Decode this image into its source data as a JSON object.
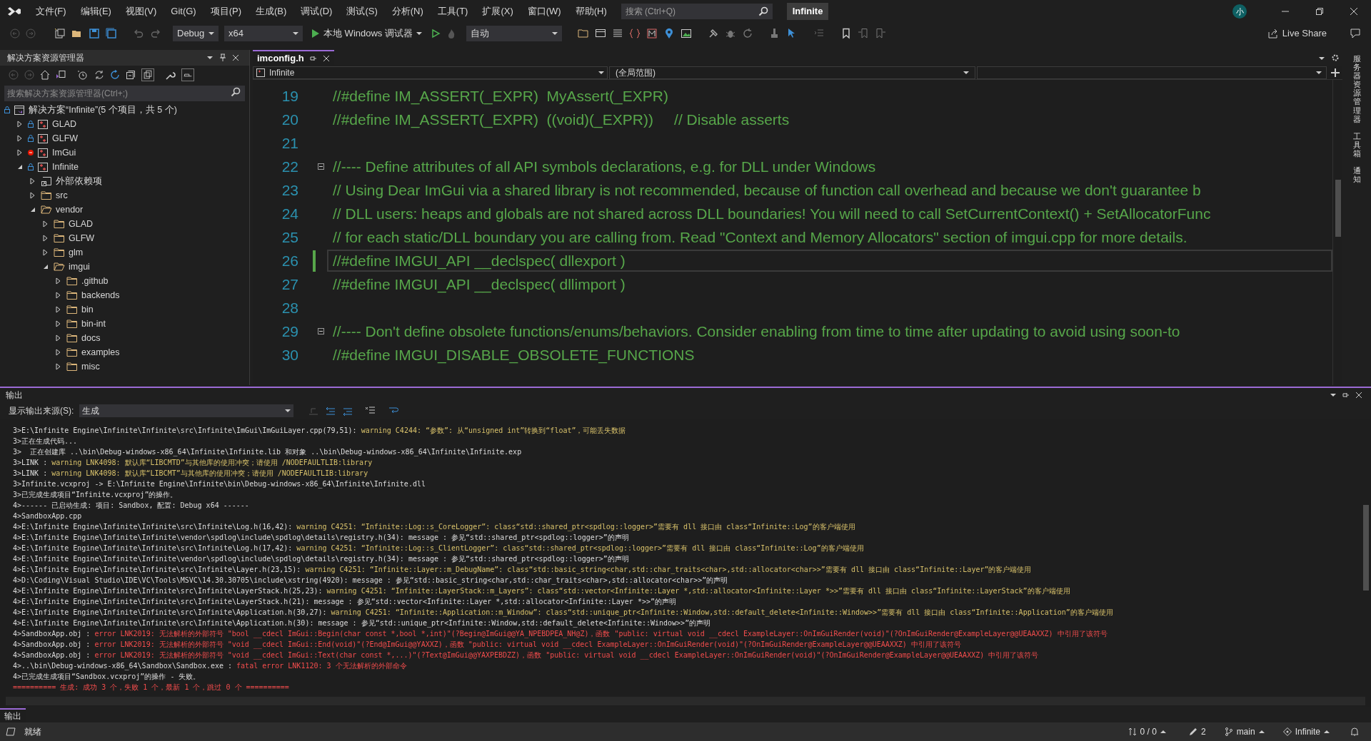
{
  "title_bar": {
    "menu": [
      "文件(F)",
      "编辑(E)",
      "视图(V)",
      "Git(G)",
      "项目(P)",
      "生成(B)",
      "调试(D)",
      "测试(S)",
      "分析(N)",
      "工具(T)",
      "扩展(X)",
      "窗口(W)",
      "帮助(H)"
    ],
    "search": {
      "placeholder": "搜索 (Ctrl+Q)"
    },
    "solution_badge": "Infinite",
    "account_initial": "小"
  },
  "toolbar": {
    "configuration": "Debug",
    "platform": "x64",
    "debugger": "本地 Windows 调试器",
    "target": "自动",
    "live_share": "Live Share"
  },
  "solution_explorer": {
    "title": "解决方案资源管理器",
    "search": {
      "placeholder": "搜索解决方案资源管理器(Ctrl+;)"
    },
    "tree": [
      {
        "label": "解决方案“Infinite”(5 个项目，共 5 个)",
        "kind": "solution",
        "locked": true,
        "has_error": false,
        "children": [
          {
            "label": "GLAD",
            "kind": "project",
            "locked": true,
            "has_error": false,
            "expanded": false
          },
          {
            "label": "GLFW",
            "kind": "project",
            "locked": true,
            "has_error": false,
            "expanded": false
          },
          {
            "label": "ImGui",
            "kind": "project",
            "locked": false,
            "has_error": true,
            "expanded": false
          },
          {
            "label": "Infinite",
            "kind": "project",
            "locked": true,
            "has_error": false,
            "expanded": true,
            "children": [
              {
                "label": "外部依赖项",
                "kind": "references",
                "expanded": false
              },
              {
                "label": "src",
                "kind": "folder",
                "expanded": false
              },
              {
                "label": "vendor",
                "kind": "folder",
                "expanded": true,
                "children": [
                  {
                    "label": "GLAD",
                    "kind": "folder",
                    "expanded": false
                  },
                  {
                    "label": "GLFW",
                    "kind": "folder",
                    "expanded": false
                  },
                  {
                    "label": "glm",
                    "kind": "folder",
                    "expanded": false
                  },
                  {
                    "label": "imgui",
                    "kind": "folder",
                    "expanded": true,
                    "children": [
                      {
                        "label": ".github",
                        "kind": "folder",
                        "expanded": false
                      },
                      {
                        "label": "backends",
                        "kind": "folder",
                        "expanded": false
                      },
                      {
                        "label": "bin",
                        "kind": "folder",
                        "expanded": false
                      },
                      {
                        "label": "bin-int",
                        "kind": "folder",
                        "expanded": false
                      },
                      {
                        "label": "docs",
                        "kind": "folder",
                        "expanded": false
                      },
                      {
                        "label": "examples",
                        "kind": "folder",
                        "expanded": false
                      },
                      {
                        "label": "misc",
                        "kind": "folder",
                        "expanded": false
                      }
                    ]
                  }
                ]
              }
            ]
          }
        ]
      }
    ]
  },
  "editor": {
    "tab": "imconfig.h",
    "project": "Infinite",
    "scope": "(全局范围)",
    "lines": [
      {
        "number": "19",
        "text": "//#define IM_ASSERT(_EXPR)  MyAssert(_EXPR)",
        "foldable": false,
        "current": false
      },
      {
        "number": "20",
        "text": "//#define IM_ASSERT(_EXPR)  ((void)(_EXPR))     // Disable asserts",
        "foldable": false,
        "current": false
      },
      {
        "number": "21",
        "foldable": false,
        "current": false
      },
      {
        "number": "22",
        "text": "//---- Define attributes of all API symbols declarations, e.g. for DLL under Windows",
        "foldable": true,
        "current": false
      },
      {
        "number": "23",
        "text": "// Using Dear ImGui via a shared library is not recommended, because of function call overhead and because we don't guarantee b",
        "foldable": false,
        "current": false
      },
      {
        "number": "24",
        "text": "// DLL users: heaps and globals are not shared across DLL boundaries! You will need to call SetCurrentContext() + SetAllocatorFunc",
        "foldable": false,
        "current": false
      },
      {
        "number": "25",
        "text": "// for each static/DLL boundary you are calling from. Read \"Context and Memory Allocators\" section of imgui.cpp for more details.",
        "foldable": false,
        "current": false
      },
      {
        "number": "26",
        "text": "//#define IMGUI_API __declspec( dllexport )",
        "foldable": false,
        "current": true
      },
      {
        "number": "27",
        "text": "//#define IMGUI_API __declspec( dllimport )",
        "foldable": false,
        "current": false
      },
      {
        "number": "28",
        "foldable": false,
        "current": false
      },
      {
        "number": "29",
        "text": "//---- Don't define obsolete functions/enums/behaviors. Consider enabling from time to time after updating to avoid using soon-to",
        "foldable": true,
        "current": false
      },
      {
        "number": "30",
        "text": "//#define IMGUI_DISABLE_OBSOLETE_FUNCTIONS",
        "foldable": false,
        "current": false
      }
    ]
  },
  "side_tabs": [
    "服务器资源管理器",
    "工具箱",
    "通知"
  ],
  "output": {
    "title": "输出",
    "source_label": "显示输出来源(S):",
    "source": "生成",
    "lines": [
      {
        "source": "3>E:\\Infinite Engine\\Infinite\\Infinite\\src\\Infinite\\ImGui\\ImGuiLayer.cpp(79,51): ",
        "text": "warning C4244: “参数”: 从“unsigned int”转换到“float”，可能丢失数据",
        "kind": "warning"
      },
      {
        "text": "3>正在生成代码...",
        "kind": "plain"
      },
      {
        "text": "3>  正在创建库 ..\\bin\\Debug-windows-x86_64\\Infinite\\Infinite.lib 和对象 ..\\bin\\Debug-windows-x86_64\\Infinite\\Infinite.exp",
        "kind": "plain"
      },
      {
        "source": "3>LINK : ",
        "text": "warning LNK4098: 默认库“LIBCMTD”与其他库的使用冲突；请使用 /NODEFAULTLIB:library",
        "kind": "warning"
      },
      {
        "source": "3>LINK : ",
        "text": "warning LNK4098: 默认库“LIBCMT”与其他库的使用冲突；请使用 /NODEFAULTLIB:library",
        "kind": "warning"
      },
      {
        "text": "3>Infinite.vcxproj -> E:\\Infinite Engine\\Infinite\\bin\\Debug-windows-x86_64\\Infinite\\Infinite.dll",
        "kind": "plain"
      },
      {
        "text": "3>已完成生成项目“Infinite.vcxproj”的操作。",
        "kind": "plain"
      },
      {
        "text": "4>------ 已启动生成: 项目: Sandbox, 配置: Debug x64 ------",
        "kind": "plain"
      },
      {
        "text": "4>SandboxApp.cpp",
        "kind": "plain"
      },
      {
        "source": "4>E:\\Infinite Engine\\Infinite\\Infinite\\src\\Infinite\\Log.h(16,42): ",
        "text": "warning C4251: “Infinite::Log::s_CoreLogger”: class“std::shared_ptr<spdlog::logger>”需要有 dll 接口由 class“Infinite::Log”的客户端使用",
        "kind": "warning"
      },
      {
        "text": "4>E:\\Infinite Engine\\Infinite\\Infinite\\vendor\\spdlog\\include\\spdlog\\details\\registry.h(34): message : 参见“std::shared_ptr<spdlog::logger>”的声明",
        "kind": "plain"
      },
      {
        "source": "4>E:\\Infinite Engine\\Infinite\\Infinite\\src\\Infinite\\Log.h(17,42): ",
        "text": "warning C4251: “Infinite::Log::s_ClientLogger”: class“std::shared_ptr<spdlog::logger>”需要有 dll 接口由 class“Infinite::Log”的客户端使用",
        "kind": "warning"
      },
      {
        "text": "4>E:\\Infinite Engine\\Infinite\\Infinite\\vendor\\spdlog\\include\\spdlog\\details\\registry.h(34): message : 参见“std::shared_ptr<spdlog::logger>”的声明",
        "kind": "plain"
      },
      {
        "source": "4>E:\\Infinite Engine\\Infinite\\Infinite\\src\\Infinite\\Layer.h(23,15): ",
        "text": "warning C4251: “Infinite::Layer::m_DebugName”: class“std::basic_string<char,std::char_traits<char>,std::allocator<char>>”需要有 dll 接口由 class“Infinite::Layer”的客户端使用",
        "kind": "warning"
      },
      {
        "text": "4>D:\\Coding\\Visual Studio\\IDE\\VC\\Tools\\MSVC\\14.30.30705\\include\\xstring(4920): message : 参见“std::basic_string<char,std::char_traits<char>,std::allocator<char>>”的声明",
        "kind": "plain"
      },
      {
        "source": "4>E:\\Infinite Engine\\Infinite\\Infinite\\src\\Infinite\\LayerStack.h(25,23): ",
        "text": "warning C4251: “Infinite::LayerStack::m_Layers”: class“std::vector<Infinite::Layer *,std::allocator<Infinite::Layer *>>”需要有 dll 接口由 class“Infinite::LayerStack”的客户端使用",
        "kind": "warning"
      },
      {
        "text": "4>E:\\Infinite Engine\\Infinite\\Infinite\\src\\Infinite\\LayerStack.h(21): message : 参见“std::vector<Infinite::Layer *,std::allocator<Infinite::Layer *>>”的声明",
        "kind": "plain"
      },
      {
        "source": "4>E:\\Infinite Engine\\Infinite\\Infinite\\src\\Infinite\\Application.h(30,27): ",
        "text": "warning C4251: “Infinite::Application::m_Window”: class“std::unique_ptr<Infinite::Window,std::default_delete<Infinite::Window>>”需要有 dll 接口由 class“Infinite::Application”的客户端使用",
        "kind": "warning"
      },
      {
        "text": "4>E:\\Infinite Engine\\Infinite\\Infinite\\src\\Infinite\\Application.h(30): message : 参见“std::unique_ptr<Infinite::Window,std::default_delete<Infinite::Window>>”的声明",
        "kind": "plain"
      },
      {
        "source": "4>SandboxApp.obj : ",
        "text": "error LNK2019: 无法解析的外部符号 \"bool __cdecl ImGui::Begin(char const *,bool *,int)\"(?Begin@ImGui@@YA_NPEBDPEA_NH@Z)，函数 \"public: virtual void __cdecl ExampleLayer::OnImGuiRender(void)\"(?OnImGuiRender@ExampleLayer@@UEAAXXZ) 中引用了该符号",
        "kind": "error"
      },
      {
        "source": "4>SandboxApp.obj : ",
        "text": "error LNK2019: 无法解析的外部符号 \"void __cdecl ImGui::End(void)\"(?End@ImGui@@YAXXZ)，函数 \"public: virtual void __cdecl ExampleLayer::OnImGuiRender(void)\"(?OnImGuiRender@ExampleLayer@@UEAAXXZ) 中引用了该符号",
        "kind": "error"
      },
      {
        "source": "4>SandboxApp.obj : ",
        "text": "error LNK2019: 无法解析的外部符号 \"void __cdecl ImGui::Text(char const *,...)\"(?Text@ImGui@@YAXPEBDZZ)，函数 \"public: virtual void __cdecl ExampleLayer::OnImGuiRender(void)\"(?OnImGuiRender@ExampleLayer@@UEAAXXZ) 中引用了该符号",
        "kind": "error"
      },
      {
        "source": "4>..\\bin\\Debug-windows-x86_64\\Sandbox\\Sandbox.exe : ",
        "text": "fatal error LNK1120: 3 个无法解析的外部命令",
        "kind": "error"
      },
      {
        "text": "4>已完成生成项目“Sandbox.vcxproj”的操作 - 失败。",
        "kind": "plain"
      },
      {
        "text": "========== 生成: 成功 3 个，失败 1 个，最新 1 个，跳过 0 个 ==========",
        "kind": "error"
      }
    ]
  },
  "bottom_tab": "输出",
  "status_bar": {
    "state": "就绪",
    "changes": "0 / 0",
    "edits": "2",
    "branch": "main",
    "repository": "Infinite"
  }
}
